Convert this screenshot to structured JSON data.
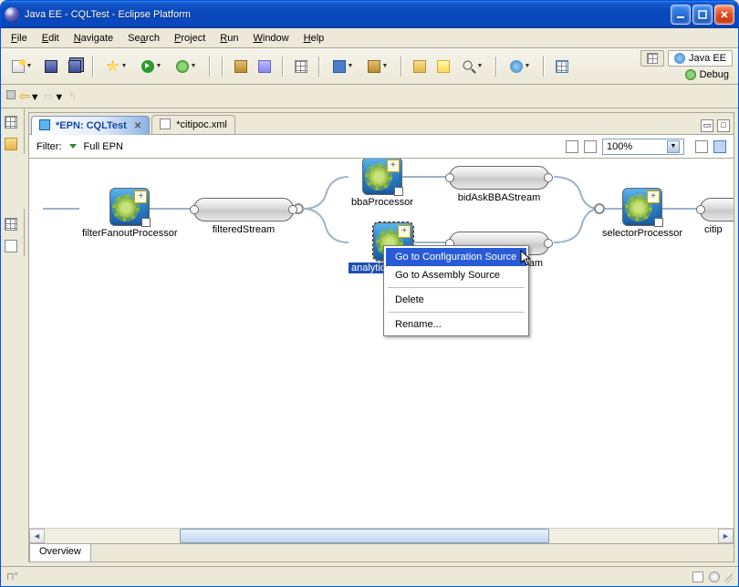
{
  "window": {
    "title": "Java EE - CQLTest - Eclipse Platform"
  },
  "menu": {
    "file": "File",
    "edit": "Edit",
    "navigate": "Navigate",
    "search": "Search",
    "project": "Project",
    "run": "Run",
    "window": "Window",
    "help": "Help"
  },
  "perspectives": {
    "javaee": "Java EE",
    "debug": "Debug"
  },
  "tabs": {
    "active": "*EPN: CQLTest",
    "inactive": "*citipoc.xml"
  },
  "filterbar": {
    "label": "Filter:",
    "scope": "Full EPN",
    "zoom": "100%"
  },
  "nodes": {
    "filterFanout": "filterFanoutProcessor",
    "filteredStream": "filteredStream",
    "bbaProcessor": "bbaProcessor",
    "analyticsProcessor": "analyticsProcessor",
    "bidAskStream": "bidAskBBAStream",
    "lowerStream": "ream",
    "selectorProcessor": "selectorProcessor",
    "citip": "citip"
  },
  "context_menu": {
    "goto_config": "Go to Configuration Source",
    "goto_assembly": "Go to Assembly Source",
    "delete": "Delete",
    "rename": "Rename..."
  },
  "overview": "Overview"
}
